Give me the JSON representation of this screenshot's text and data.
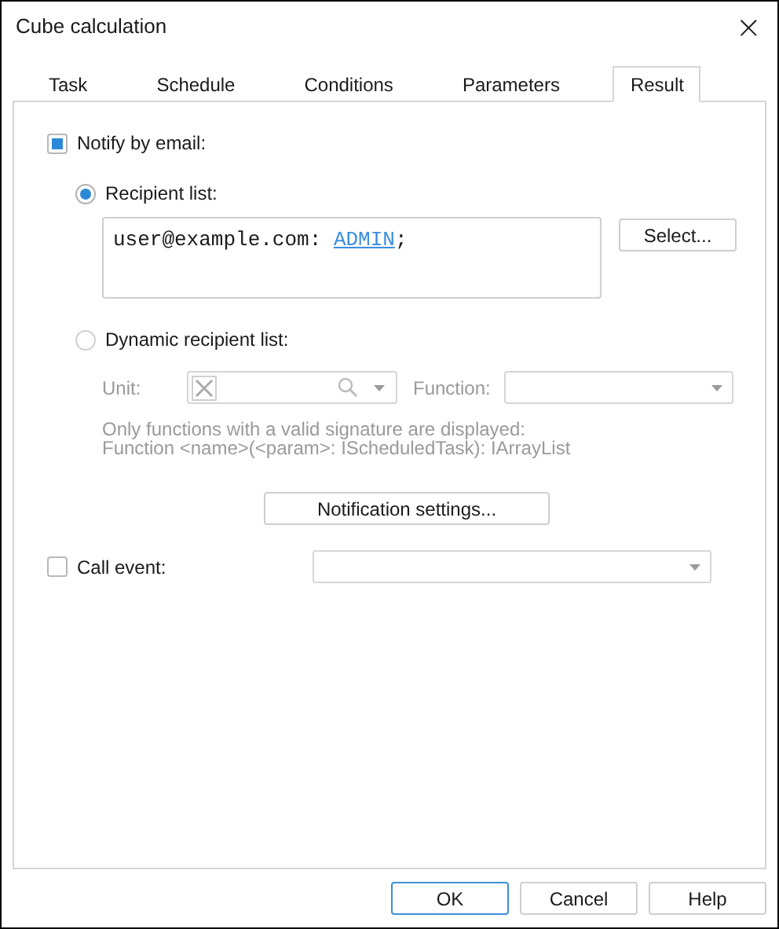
{
  "window": {
    "title": "Cube calculation",
    "close": "×"
  },
  "tabs": [
    {
      "label": "Task",
      "selected": false
    },
    {
      "label": "Schedule",
      "selected": false
    },
    {
      "label": "Conditions",
      "selected": false
    },
    {
      "label": "Parameters",
      "selected": false
    },
    {
      "label": "Result",
      "selected": true
    }
  ],
  "notify": {
    "label": "Notify by email:",
    "checked": true
  },
  "recipient_list": {
    "label": "Recipient list:",
    "selected": true,
    "address": "user@example.com:",
    "user": "ADMIN",
    "separator": ";",
    "select_button": "Select..."
  },
  "dynamic_list": {
    "label": "Dynamic recipient list:",
    "selected": false,
    "disabled": true,
    "unit_label": "Unit:",
    "function_label": "Function:",
    "hint": "Only functions with a valid signature are displayed: Function <name>(<param>: IScheduledTask): IArrayList"
  },
  "notification_settings": "Notification settings...",
  "call_event": {
    "label": "Call event:",
    "checked": false
  },
  "buttons": [
    {
      "label": "OK",
      "default": true
    },
    {
      "label": "Cancel",
      "default": false
    },
    {
      "label": "Help",
      "default": false
    }
  ]
}
